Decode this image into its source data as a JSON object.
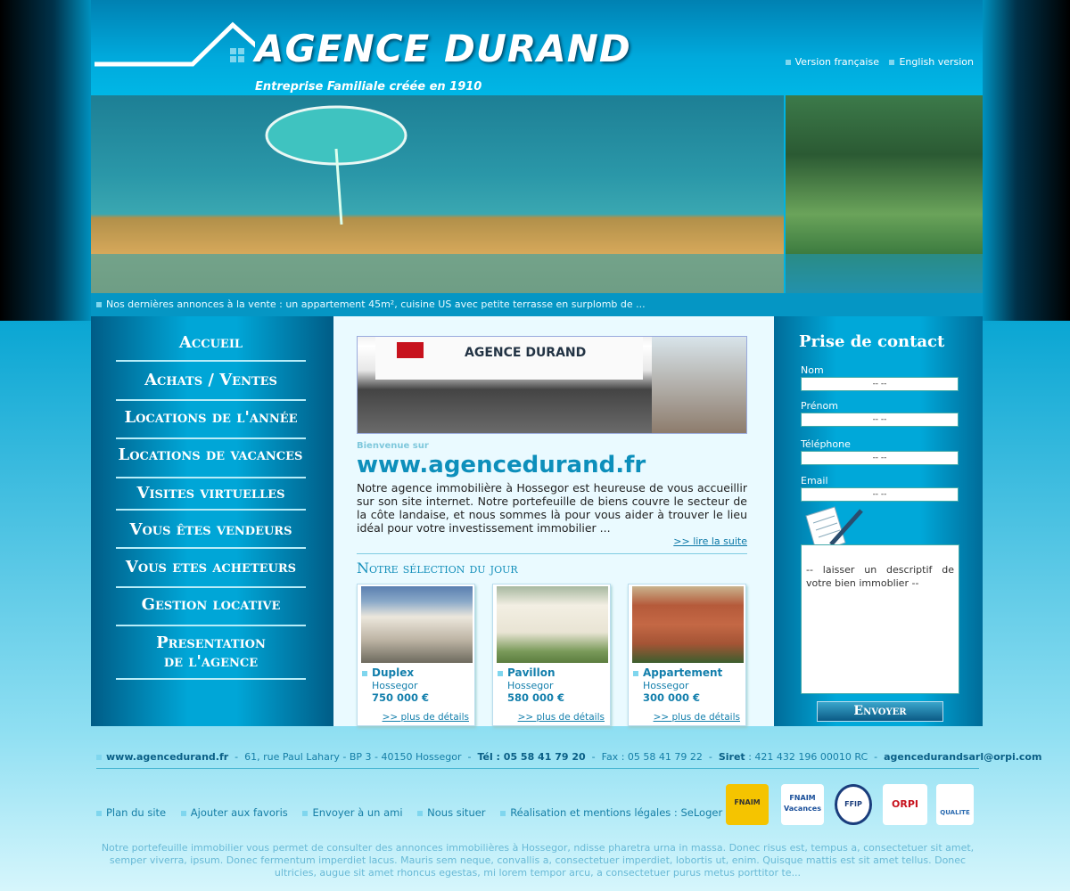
{
  "header": {
    "logo": "AGENCE DURAND",
    "tagline": "Entreprise Familiale créée en 1910",
    "lang_fr": "Version française",
    "lang_en": "English version"
  },
  "ticker": "Nos dernières annonces à la vente : un appartement 45m², cuisine US avec petite terrasse en surplomb de ...",
  "nav": {
    "items": [
      "Accueil",
      "Achats / Ventes",
      "Locations de l'année",
      "Locations de vacances",
      "Visites virtuelles",
      "Vous êtes vendeurs",
      "Vous etes acheteurs",
      "Gestion locative",
      "Presentation",
      "de l'agence"
    ]
  },
  "main": {
    "shop_sign": "AGENCE DURAND",
    "welcome_sub": "Bienvenue sur",
    "welcome_url": "www.agencedurand.fr",
    "intro": "Notre agence immobilière à Hossegor est heureuse de vous accueillir sur son site internet. Notre portefeuille de biens couvre le secteur de la côte landaise, et nous sommes là pour vous aider à trouver le lieu idéal pour votre investissement immobilier ...",
    "read_more": ">> lire la suite",
    "selection_title": "Notre sélection du jour",
    "cards": [
      {
        "type": "Duplex",
        "place": "Hossegor",
        "price": "750 000 €",
        "more": ">> plus de détails"
      },
      {
        "type": "Pavillon",
        "place": "Hossegor",
        "price": "580 000 €",
        "more": ">> plus de détails"
      },
      {
        "type": "Appartement",
        "place": "Hossegor",
        "price": "300 000 €",
        "more": ">> plus de détails"
      }
    ]
  },
  "contact": {
    "title": "Prise de contact",
    "nom": "Nom",
    "prenom": "Prénom",
    "telephone": "Téléphone",
    "email": "Email",
    "placeholder": "-- --",
    "message": "-- laisser un descriptif de votre bien immoblier --",
    "send": "Envoyer"
  },
  "footer": {
    "site": "www.agencedurand.fr",
    "address": "61, rue Paul Lahary - BP 3 - 40150 Hossegor",
    "tel": "Tél : 05 58 41 79 20",
    "fax": "Fax : 05 58 41 79 22",
    "siret_label": "Siret",
    "siret": ": 421 432 196 00010 RC",
    "email": "agencedurandsarl@orpi.com",
    "links": [
      "Plan du site",
      "Ajouter aux favoris",
      "Envoyer à un ami",
      "Nous situer",
      "Réalisation et mentions légales : SeLoger"
    ],
    "badges": [
      "FNAIM",
      "FNAIM Vacances",
      "FFIP",
      "ORPI",
      "QUALITE"
    ],
    "text": "Notre portefeuille immobilier vous permet de consulter des annonces immobilières à  Hossegor, ndisse pharetra urna in massa. Donec risus est, tempus a, consectetuer sit amet, semper viverra, ipsum. Donec fermentum imperdiet lacus. Mauris sem neque, convallis a, consectetuer imperdiet, lobortis ut, enim. Quisque mattis est sit amet tellus. Donec ultricies, augue sit amet rhoncus egestas, mi lorem tempor arcu, a consectetuer purus metus porttitor te..."
  }
}
